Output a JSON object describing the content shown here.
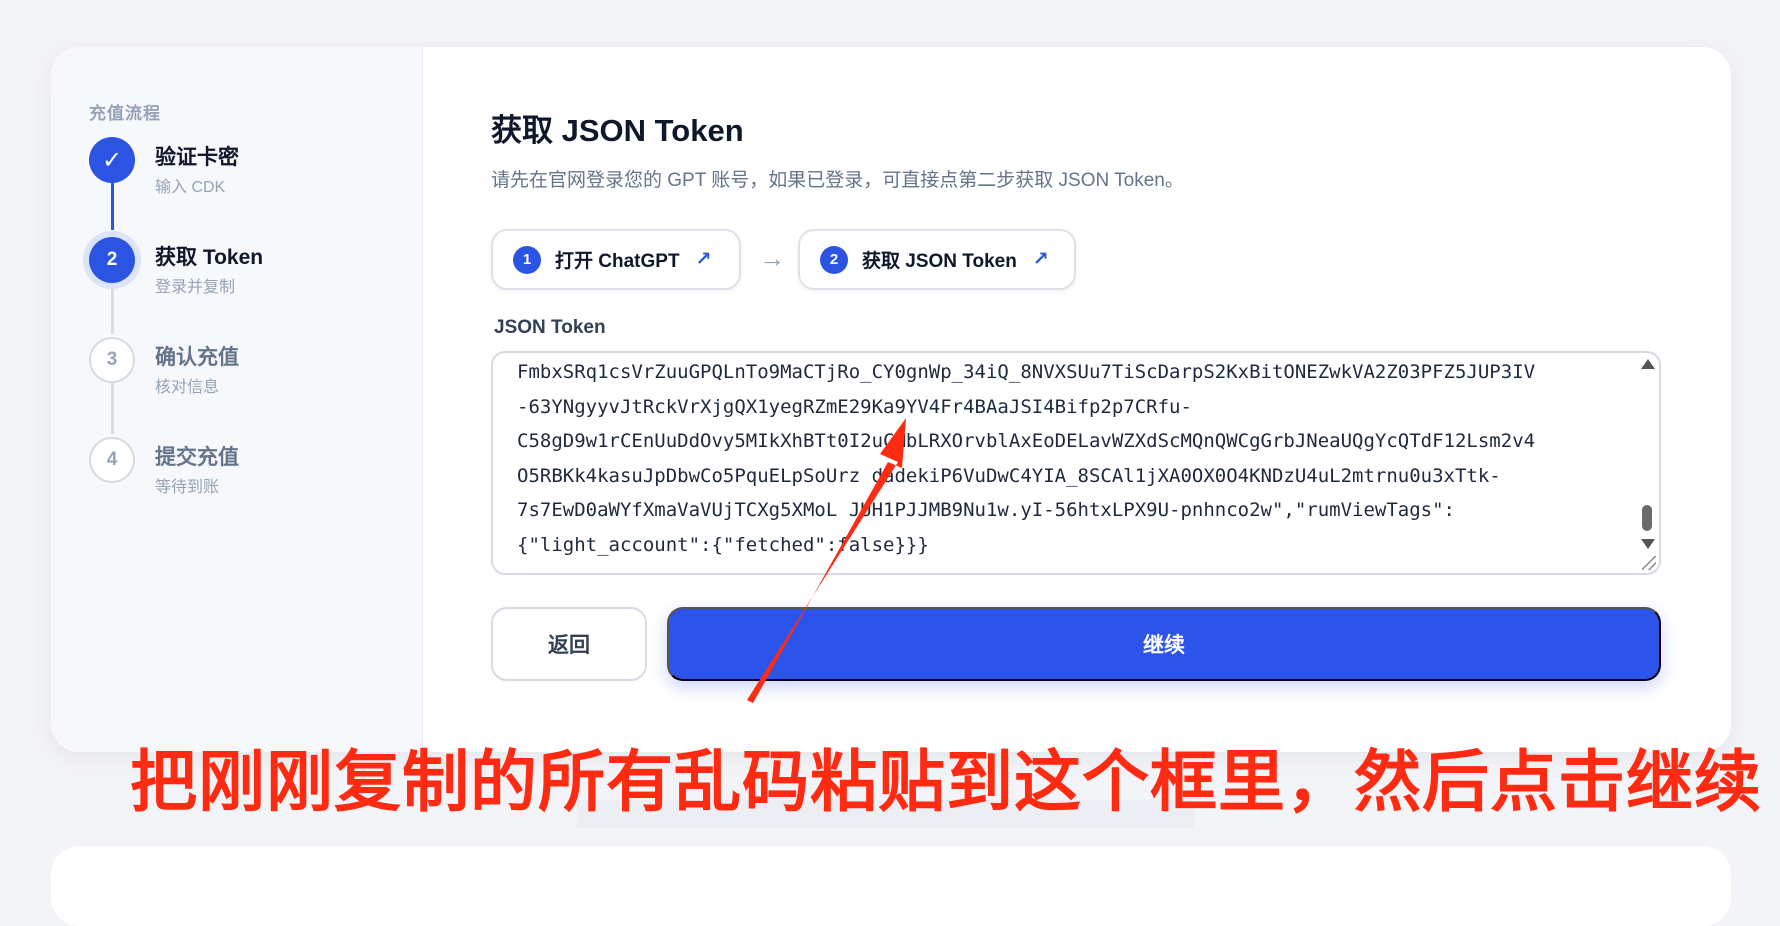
{
  "sidebar": {
    "heading": "充值流程",
    "steps": [
      {
        "indicator": "✓",
        "title": "验证卡密",
        "subtitle": "输入 CDK",
        "state": "done"
      },
      {
        "indicator": "2",
        "title": "获取 Token",
        "subtitle": "登录并复制",
        "state": "active"
      },
      {
        "indicator": "3",
        "title": "确认充值",
        "subtitle": "核对信息",
        "state": "todo"
      },
      {
        "indicator": "4",
        "title": "提交充值",
        "subtitle": "等待到账",
        "state": "todo"
      }
    ]
  },
  "main": {
    "title": "获取 JSON Token",
    "description": "请先在官网登录您的 GPT 账号，如果已登录，可直接点第二步获取 JSON Token。",
    "links": [
      {
        "number": "1",
        "label": "打开 ChatGPT",
        "arrow_icon": "external-link-icon"
      },
      {
        "number": "2",
        "label": "获取 JSON Token",
        "arrow_icon": "external-link-icon"
      }
    ],
    "link_separator": "→",
    "field_label": "JSON Token",
    "token_lines": [
      "FmbxSRq1csVrZuuGPQLnTo9MaCTjRo_CY0gnWp_34iQ_8NVXSUu7TiScDarpS2KxBitONEZwkVA2Z03PFZ5JUP3IV",
      "-63YNgyyvJtRckVrXjgQX1yegRZmE29Ka9YV4Fr4BAaJSI4Bifp2p7CRfu-",
      "C58gD9w1rCEnUuDdOvy5MIkXhBTt0I2uCMbLRXOrvblAxEoDELavWZXdScMQnQWCgGrbJNeaUQgYcQTdF12Lsm2v4",
      "O5RBKk4kasuJpDbwCo5PquELpSoUrz dadekiP6VuDwC4YIA_8SCAl1jXA0OX0O4KNDzU4uL2mtrnu0u3xTtk-",
      "7s7EwD0aWYfXmaVaVUjTCXg5XMoL JUH1PJJMB9Nu1w.yI-56htxLPX9U-pnhnco2w\",\"rumViewTags\":",
      "{\"light_account\":{\"fetched\":false}}}"
    ],
    "back_button": "返回",
    "continue_button": "继续"
  },
  "annotation": {
    "text": "把刚刚复制的所有乱码粘贴到这个框里，然后点击继续",
    "color": "#ff2a12"
  },
  "colors": {
    "accent": "#2c54eb",
    "muted": "#94a3b8"
  }
}
